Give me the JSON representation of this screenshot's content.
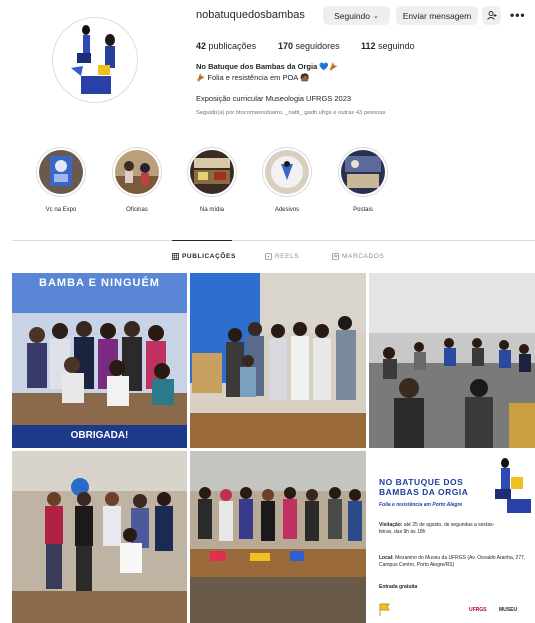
{
  "profile": {
    "username": "nobatuquedosbambas",
    "following_button": "Seguindo",
    "message_button": "Enviar mensagem",
    "posts_count": "42",
    "posts_label": "publicações",
    "followers_count": "170",
    "followers_label": "seguidores",
    "following_count": "112",
    "following_label": "seguindo",
    "bio_name": "No Batuque dos Bambas da Orgia 💙🪘",
    "bio_line": "🪘 Folia e resistência em POA 🧑🏾",
    "bio_link": "Exposição curricular Museologia UFRGS 2023",
    "followed_by": "Seguido(a) por blocomasnobairro, _natti_ gadh.ufrgs e outras 43 pessoas"
  },
  "highlights": [
    {
      "label": "Vc na Expo"
    },
    {
      "label": "Oficinas"
    },
    {
      "label": "Na mídia"
    },
    {
      "label": "Adesivos"
    },
    {
      "label": "Postais"
    }
  ],
  "tabs": [
    {
      "label": "PUBLICAÇÕES",
      "active": true
    },
    {
      "label": "REELS",
      "active": false
    },
    {
      "label": "MARCADOS",
      "active": false
    }
  ],
  "posts": {
    "post1_top_text": "BAMBA E NINGUÉM",
    "post1_banner": "OBRIGADA!",
    "post6_title": "NO BATUQUE DOS BAMBAS DA ORGIA",
    "post6_subtitle": "Folia e resistência em Porto Alegre",
    "post6_visit_label": "Visitação:",
    "post6_visit_text": "até 25 de agosto, de segundas a sextas-feiras, das 9h às 18h",
    "post6_location_label": "Local:",
    "post6_location_text": "Mezanino do Museu da UFRGS (Av. Osvaldo Aranha, 277, Campus Centro, Porto Alegre/RS)",
    "post6_entry": "Entrada gratuita",
    "post6_logo1": "UFRGS",
    "post6_logo2": "MUSEU"
  },
  "colors": {
    "accent_blue": "#1f3f9f",
    "story_bg": "#f5f5f5"
  }
}
